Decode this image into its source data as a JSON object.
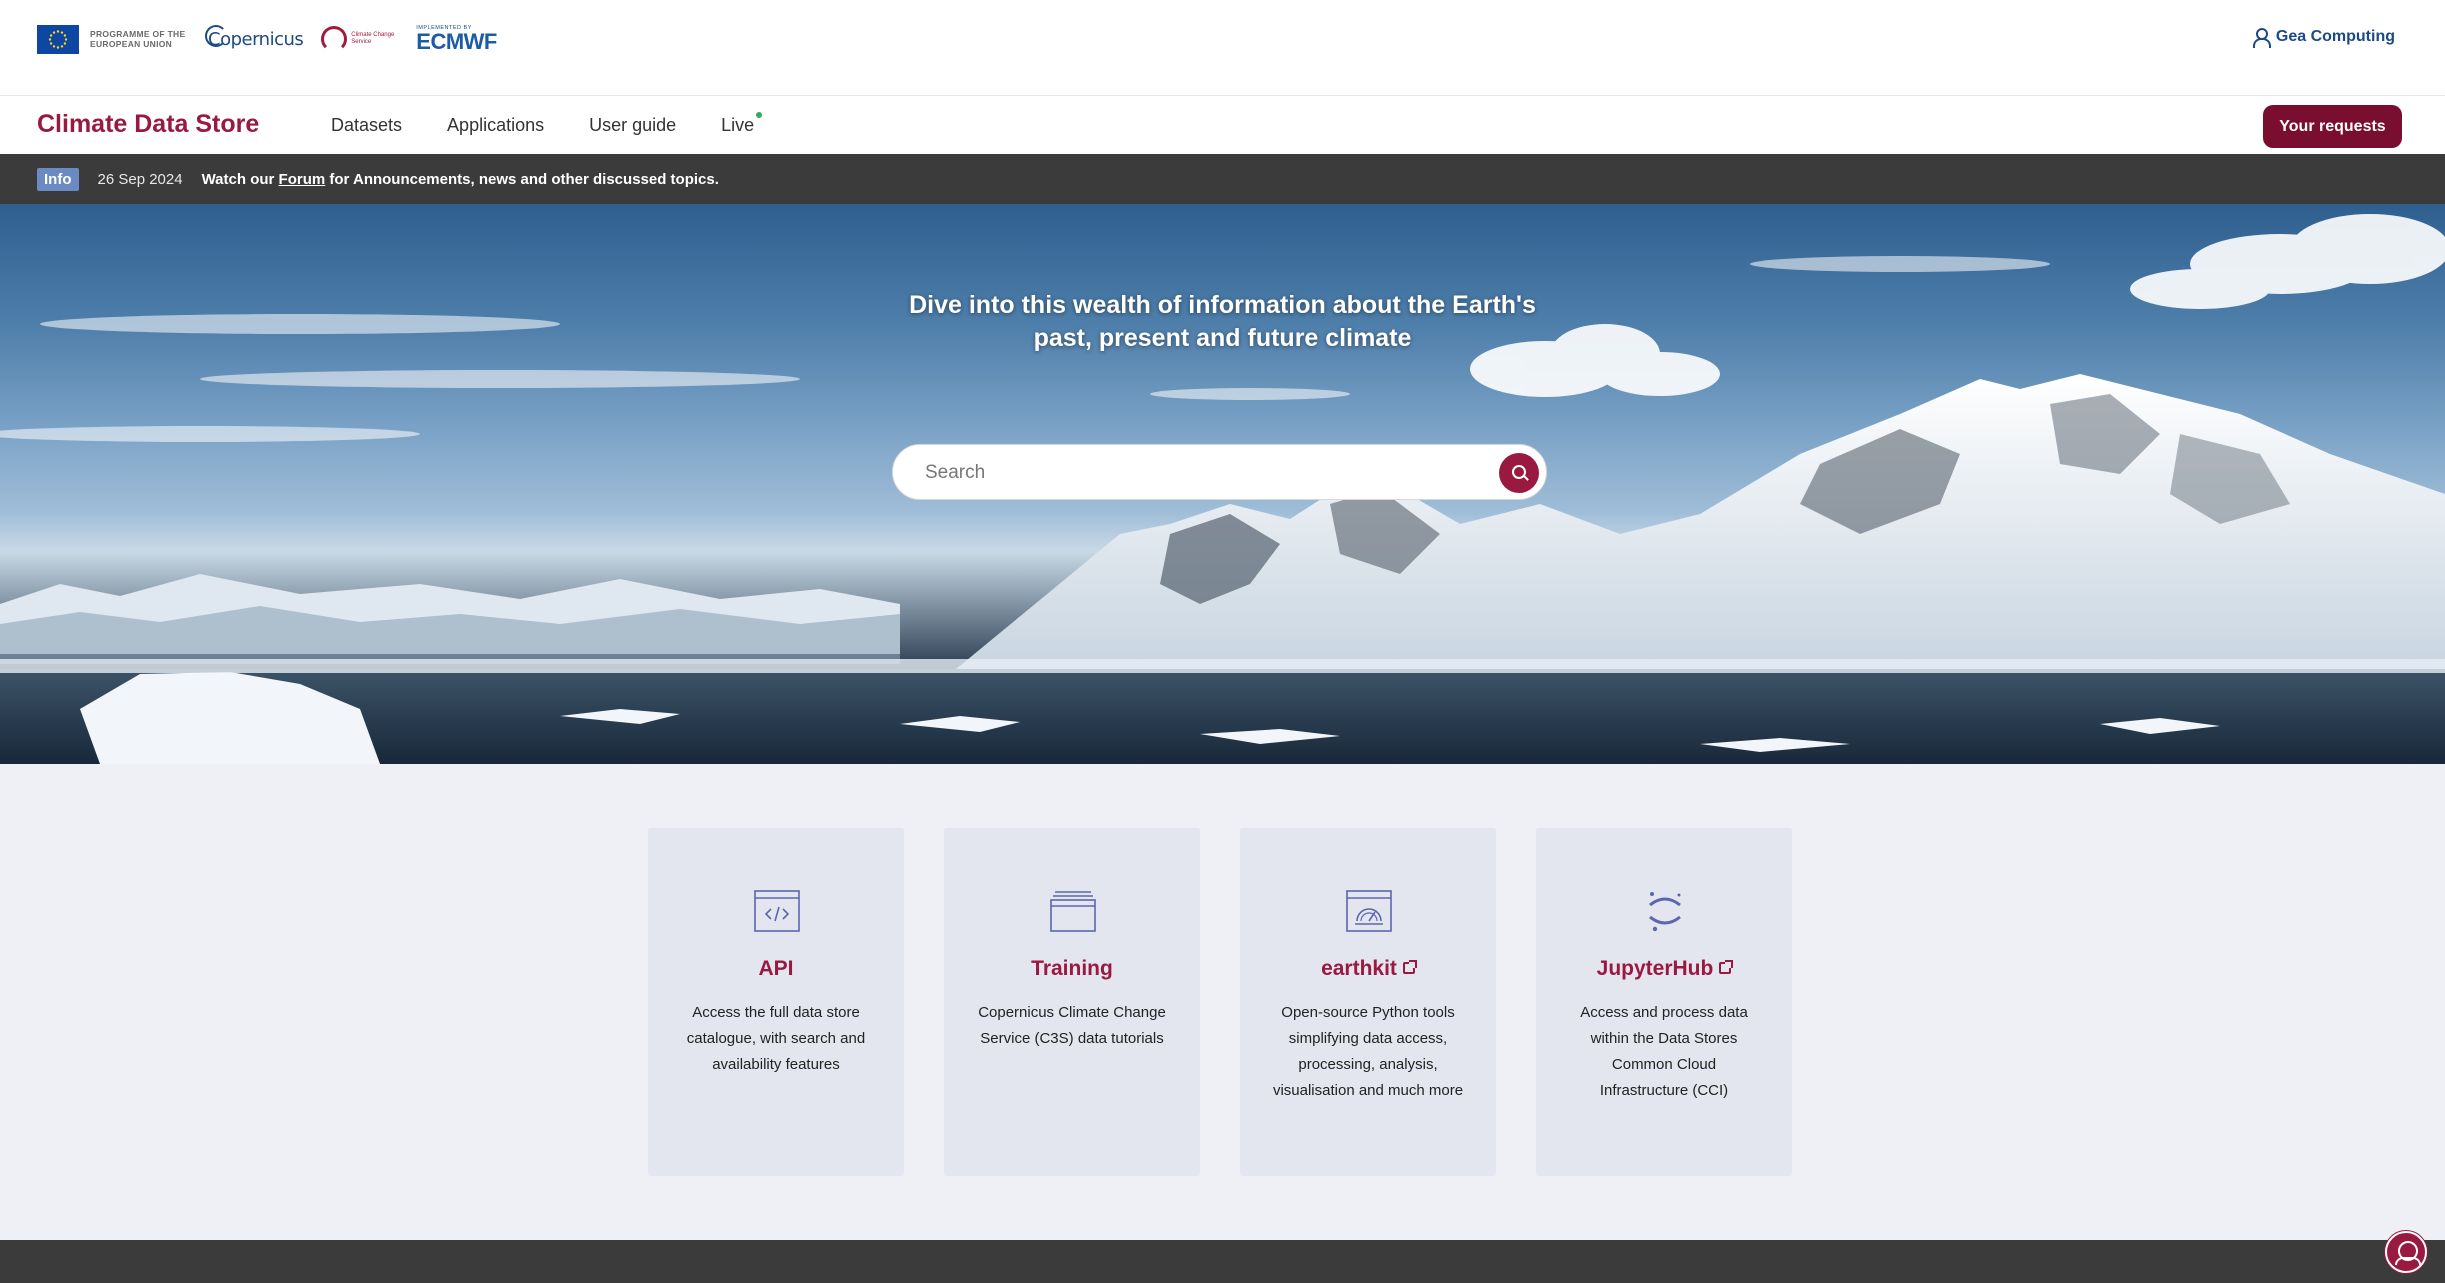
{
  "header": {
    "eu_programme_text": "PROGRAMME OF THE EUROPEAN UNION",
    "copernicus_logo_text": "Copernicus",
    "c3s_logo_text": "Climate Change Service",
    "ecmwf_small_text": "IMPLEMENTED BY",
    "ecmwf_logo_text": "ECMWF",
    "user_name": "Gea Computing"
  },
  "nav": {
    "brand": "Climate Data Store",
    "items": [
      {
        "label": "Datasets"
      },
      {
        "label": "Applications"
      },
      {
        "label": "User guide"
      },
      {
        "label": "Live"
      }
    ],
    "requests_button": "Your requests",
    "live_status_color": "#2fae57"
  },
  "info_bar": {
    "badge": "Info",
    "date": "26 Sep 2024",
    "message_prefix": "Watch our",
    "link_text": "Forum",
    "message_suffix": "for Announcements, news and other discussed topics."
  },
  "hero": {
    "title_line1": "Dive into this wealth of information about the Earth's",
    "title_line2": "past, present and future climate",
    "search_placeholder": "Search"
  },
  "cards": [
    {
      "title": "API",
      "description": "Access the full data store catalogue, with search and availability features",
      "icon": "code-window-icon",
      "external": false
    },
    {
      "title": "Training",
      "description": "Copernicus Climate Change Service (C3S) data tutorials",
      "icon": "stacked-window-icon",
      "external": false
    },
    {
      "title": "earthkit",
      "description": "Open-source Python tools simplifying data access, processing, analysis, visualisation and much more",
      "icon": "dashboard-window-icon",
      "external": true
    },
    {
      "title": "JupyterHub",
      "description": "Access and process data within the Data Stores Common Cloud Infrastructure (CCI)",
      "icon": "jupyter-icon",
      "external": true
    }
  ],
  "colors": {
    "brand": "#9a1941",
    "button": "#7a0e30",
    "info_badge": "#6b89c3",
    "dark_bar": "#3b3b3b",
    "link_blue": "#1c4a82"
  }
}
